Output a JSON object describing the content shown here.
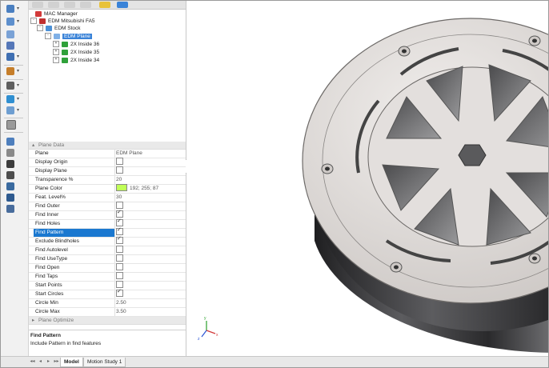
{
  "tree": {
    "nodes": [
      {
        "label": "MAC Manager",
        "icon": "mac-manager-icon"
      },
      {
        "label": "EDM Mitsubishi FA5",
        "icon": "machine-icon",
        "expander": "-"
      },
      {
        "label": "EDM Stock",
        "icon": "stock-icon",
        "expander": "-"
      },
      {
        "label": "EDM Plane",
        "icon": "plane-icon",
        "expander": "-"
      },
      {
        "label": "2X Inside 36",
        "icon": "feature-icon",
        "expander": "+"
      },
      {
        "label": "2X Inside 35",
        "icon": "feature-icon",
        "expander": "+"
      },
      {
        "label": "2X Inside 34",
        "icon": "feature-icon",
        "expander": "+"
      }
    ]
  },
  "properties": {
    "section_title": "Plane Data",
    "section_collapse_glyph": "▴",
    "rows": [
      {
        "key": "Plane",
        "value": "EDM Plane"
      },
      {
        "key": "Display Origin",
        "value": ""
      },
      {
        "key": "Display Plane",
        "value": ""
      },
      {
        "key": "Transparence %",
        "value": "20"
      },
      {
        "key": "Plane Color",
        "value": "192; 255; 87"
      },
      {
        "key": "Feat. Level%",
        "value": "30"
      },
      {
        "key": "Find Outer",
        "value": ""
      },
      {
        "key": "Find Inner",
        "value": ""
      },
      {
        "key": "Find Holes",
        "value": ""
      },
      {
        "key": "Find Pattern",
        "value": ""
      },
      {
        "key": "Exclude Blindholes",
        "value": ""
      },
      {
        "key": "Find Autolevel",
        "value": ""
      },
      {
        "key": "Find UseType",
        "value": ""
      },
      {
        "key": "Find Open",
        "value": ""
      },
      {
        "key": "Find Taps",
        "value": ""
      },
      {
        "key": "Start Points",
        "value": ""
      },
      {
        "key": "Start Circles",
        "value": ""
      },
      {
        "key": "Circle Min",
        "value": "2.50"
      },
      {
        "key": "Circle Max",
        "value": "3.50"
      }
    ],
    "checkbox_states": {
      "Display Origin": false,
      "Display Plane": false,
      "Find Outer": false,
      "Find Inner": true,
      "Find Holes": true,
      "Find Pattern": true,
      "Exclude Blindholes": true,
      "Find Autolevel": false,
      "Find UseType": false,
      "Find Open": false,
      "Find Taps": false,
      "Start Points": false,
      "Start Circles": true
    },
    "plane_color_hex": "#c0ff57",
    "selected_row": "Find Pattern",
    "section2_title": "Plane Optimize",
    "section2_collapse_glyph": "▸"
  },
  "description": {
    "title": "Find Pattern",
    "text": "Include Pattern in find features"
  },
  "bottom_tabs": [
    "Model",
    "Motion Study 1"
  ],
  "bottom_nav": [
    "◂◂",
    "◂",
    "▸",
    "▸▸"
  ],
  "colors": {
    "selection": "#1a78d0",
    "tree_selection": "#3a83d8",
    "part_face": "#d2d2d4",
    "part_dark": "#3c3c3e"
  },
  "triad": {
    "x": "x",
    "y": "y",
    "z": "z"
  }
}
